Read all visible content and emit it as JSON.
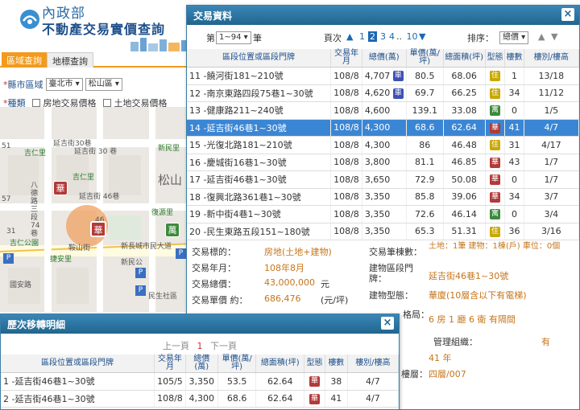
{
  "header": {
    "title_line1": "內政部",
    "title_line2": "不動產交易實價查詢"
  },
  "map_tabs": [
    "區域查詢",
    "地標查詢"
  ],
  "filters": {
    "region_label": "縣市區域",
    "city": "臺北市",
    "district": "松山區",
    "type_label": "種類",
    "option_house": "房地交易價格",
    "option_land": "土地交易價格"
  },
  "map_labels": {
    "l1": "延吉街30巷",
    "l2": "吉仁里",
    "l3": "延吉街 30 巷",
    "l4": "新民里",
    "l5": "吉仁里",
    "l6": "延吉街 46巷",
    "l7": "八德路三段 74巷",
    "l8": "復源里",
    "l9": "松山",
    "l10": "新長城市民大道",
    "l11": "吉仁公園",
    "l12": "鞍山街",
    "l13": "捷安里",
    "l14": "新民公",
    "l15": "國安路",
    "l16": "51",
    "l17": "57",
    "l18": "31",
    "l19": "46",
    "l20": "民生社區",
    "map_pin": "華",
    "map_pin2": "萬"
  },
  "tx_window": {
    "title": "交易資料",
    "range_label": "第",
    "range_value": "1~94",
    "range_suffix": "筆",
    "page_label": "頁次",
    "pages": [
      "1",
      "2",
      "3",
      "4",
      "..",
      "10"
    ],
    "current_page": "2",
    "sort_label": "排序：",
    "sort_value": "總價",
    "columns": [
      "區段位置或區段門牌",
      "交易年月",
      "總價(萬)",
      "單價(萬/坪)",
      "總面積(坪)",
      "型態",
      "樓數",
      "樓別/樓高"
    ],
    "rows": [
      {
        "no": "11",
        "addr": "饒河街181~210號",
        "date": "108/8",
        "total": "4,707",
        "badge": "車",
        "badge_color": "blue",
        "unit": "80.5",
        "area": "68.06",
        "type": "住",
        "type_color": "yellow",
        "floors": "1",
        "level": "13/18"
      },
      {
        "no": "12",
        "addr": "南京東路四段75巷1~30號",
        "date": "108/8",
        "total": "4,620",
        "badge": "車",
        "badge_color": "blue",
        "unit": "69.7",
        "area": "66.25",
        "type": "住",
        "type_color": "yellow",
        "floors": "34",
        "level": "11/12"
      },
      {
        "no": "13",
        "addr": "健康路211~240號",
        "date": "108/8",
        "total": "4,600",
        "badge": "",
        "badge_color": "",
        "unit": "139.1",
        "area": "33.08",
        "type": "寓",
        "type_color": "green",
        "floors": "0",
        "level": "1/5"
      },
      {
        "no": "14",
        "addr": "延吉街46巷1~30號",
        "date": "108/8",
        "total": "4,300",
        "badge": "",
        "badge_color": "",
        "unit": "68.6",
        "area": "62.64",
        "type": "華",
        "type_color": "red",
        "floors": "41",
        "level": "4/7"
      },
      {
        "no": "15",
        "addr": "光復北路181~210號",
        "date": "108/8",
        "total": "4,300",
        "badge": "",
        "badge_color": "",
        "unit": "86",
        "area": "46.48",
        "type": "住",
        "type_color": "yellow",
        "floors": "31",
        "level": "4/17"
      },
      {
        "no": "16",
        "addr": "慶城街16巷1~30號",
        "date": "108/8",
        "total": "3,800",
        "badge": "",
        "badge_color": "",
        "unit": "81.1",
        "area": "46.85",
        "type": "華",
        "type_color": "red",
        "floors": "43",
        "level": "1/7"
      },
      {
        "no": "17",
        "addr": "延吉街46巷1~30號",
        "date": "108/8",
        "total": "3,650",
        "badge": "",
        "badge_color": "",
        "unit": "72.9",
        "area": "50.08",
        "type": "華",
        "type_color": "red",
        "floors": "0",
        "level": "1/7"
      },
      {
        "no": "18",
        "addr": "復興北路361巷1~30號",
        "date": "108/8",
        "total": "3,350",
        "badge": "",
        "badge_color": "",
        "unit": "85.8",
        "area": "39.06",
        "type": "華",
        "type_color": "red",
        "floors": "34",
        "level": "3/7"
      },
      {
        "no": "19",
        "addr": "新中街4巷1~30號",
        "date": "108/8",
        "total": "3,350",
        "badge": "",
        "badge_color": "",
        "unit": "72.6",
        "area": "46.14",
        "type": "寓",
        "type_color": "green",
        "floors": "0",
        "level": "3/4"
      },
      {
        "no": "20",
        "addr": "民生東路五段151~180號",
        "date": "108/8",
        "total": "3,350",
        "badge": "",
        "badge_color": "",
        "unit": "65.3",
        "area": "51.31",
        "type": "住",
        "type_color": "yellow",
        "floors": "36",
        "level": "3/16"
      }
    ],
    "detail": {
      "target_label": "交易標的：",
      "target_value": "房地(土地+建物)",
      "date_label": "交易年月：",
      "date_value": "108年8月",
      "total_label": "交易總價：",
      "total_value": "43,000,000",
      "total_unit": "元",
      "unit_label": "交易單價 約：",
      "unit_value": "686,476",
      "unit_unit": "(元/坪)",
      "count_label": "交易筆棟數：",
      "count_value": "土地：1筆 建物：1棟(戶) 車位：0個",
      "addr_label": "建物區段門牌：",
      "addr_value": "延吉街46巷1~30號",
      "btype_label": "建物型態：",
      "btype_value": "華廈(10層含以下有電梯)",
      "rooms_label": "格局：",
      "rooms_value": "6 房 1 廳 6 衛 有隔間",
      "mgmt_label": "管理組織：",
      "mgmt_value": "有",
      "age_value": "41 年",
      "floor_label": "樓層：",
      "floor_value": "四層/007"
    }
  },
  "history_window": {
    "title": "歷次移轉明細",
    "prev": "上一頁",
    "page": "1",
    "next": "下一頁",
    "columns": [
      "區段位置或區段門牌",
      "交易年月",
      "總價(萬)",
      "單價(萬/坪)",
      "總面積(坪)",
      "型態",
      "樓數",
      "樓別/樓高"
    ],
    "rows": [
      {
        "no": "1",
        "addr": "延吉街46巷1~30號",
        "date": "105/5",
        "total": "3,350",
        "unit": "53.5",
        "area": "62.64",
        "type": "華",
        "floors": "38",
        "level": "4/7"
      },
      {
        "no": "2",
        "addr": "延吉街46巷1~30號",
        "date": "108/8",
        "total": "4,300",
        "unit": "68.6",
        "area": "62.64",
        "type": "華",
        "floors": "41",
        "level": "4/7"
      }
    ]
  },
  "colors": {
    "accent_orange": "#f39a1c",
    "title_blue": "#20668f",
    "selected_row": "#3b86d4",
    "value_orange": "#c6751b"
  }
}
